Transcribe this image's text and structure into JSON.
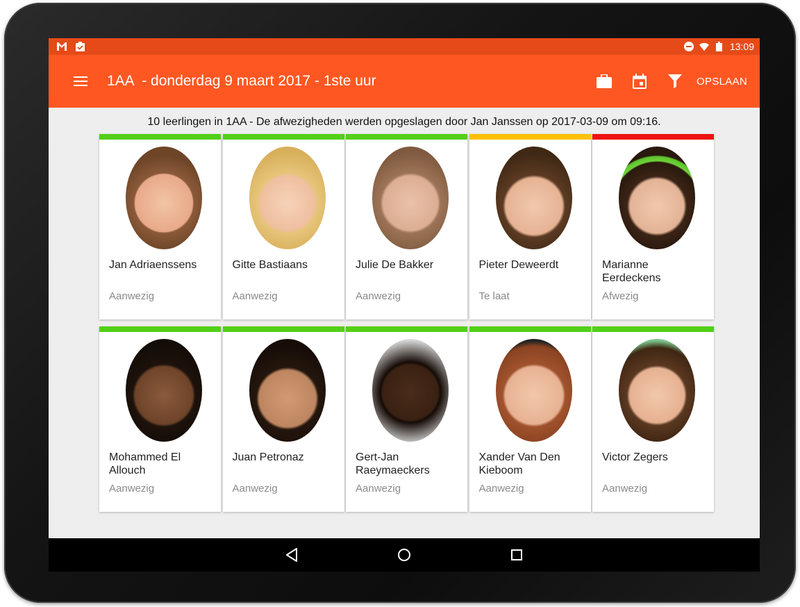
{
  "statusbar": {
    "time": "13:09",
    "left_icons": [
      "gmail-icon",
      "clipboard-check-icon"
    ],
    "right_icons": [
      "do-not-disturb-icon",
      "wifi-icon",
      "battery-icon"
    ]
  },
  "appbar": {
    "title": "1AA  - donderdag 9 maart 2017 - 1ste uur",
    "actions": [
      "briefcase-icon",
      "calendar-icon",
      "filter-icon"
    ],
    "save_label": "OPSLAAN"
  },
  "summary": "10 leerlingen in 1AA - De afwezigheden werden opgeslagen door Jan Janssen op 2017-03-09 om 09:16.",
  "status_colors": {
    "Aanwezig": "#52d017",
    "Te laat": "#ffc107",
    "Afwezig": "#f01010"
  },
  "students": [
    {
      "name": "Jan Adriaenssens",
      "status": "Aanwezig"
    },
    {
      "name": "Gitte Bastiaans",
      "status": "Aanwezig"
    },
    {
      "name": "Julie De Bakker",
      "status": "Aanwezig"
    },
    {
      "name": "Pieter Deweerdt",
      "status": "Te laat"
    },
    {
      "name": "Marianne Eerdeckens",
      "status": "Afwezig"
    },
    {
      "name": "Mohammed El Allouch",
      "status": "Aanwezig"
    },
    {
      "name": "Juan Petronaz",
      "status": "Aanwezig"
    },
    {
      "name": "Gert-Jan Raeymaeckers",
      "status": "Aanwezig"
    },
    {
      "name": "Xander Van Den Kieboom",
      "status": "Aanwezig"
    },
    {
      "name": "Victor Zegers",
      "status": "Aanwezig"
    }
  ],
  "navbar": [
    "back-icon",
    "home-icon",
    "recents-icon"
  ]
}
